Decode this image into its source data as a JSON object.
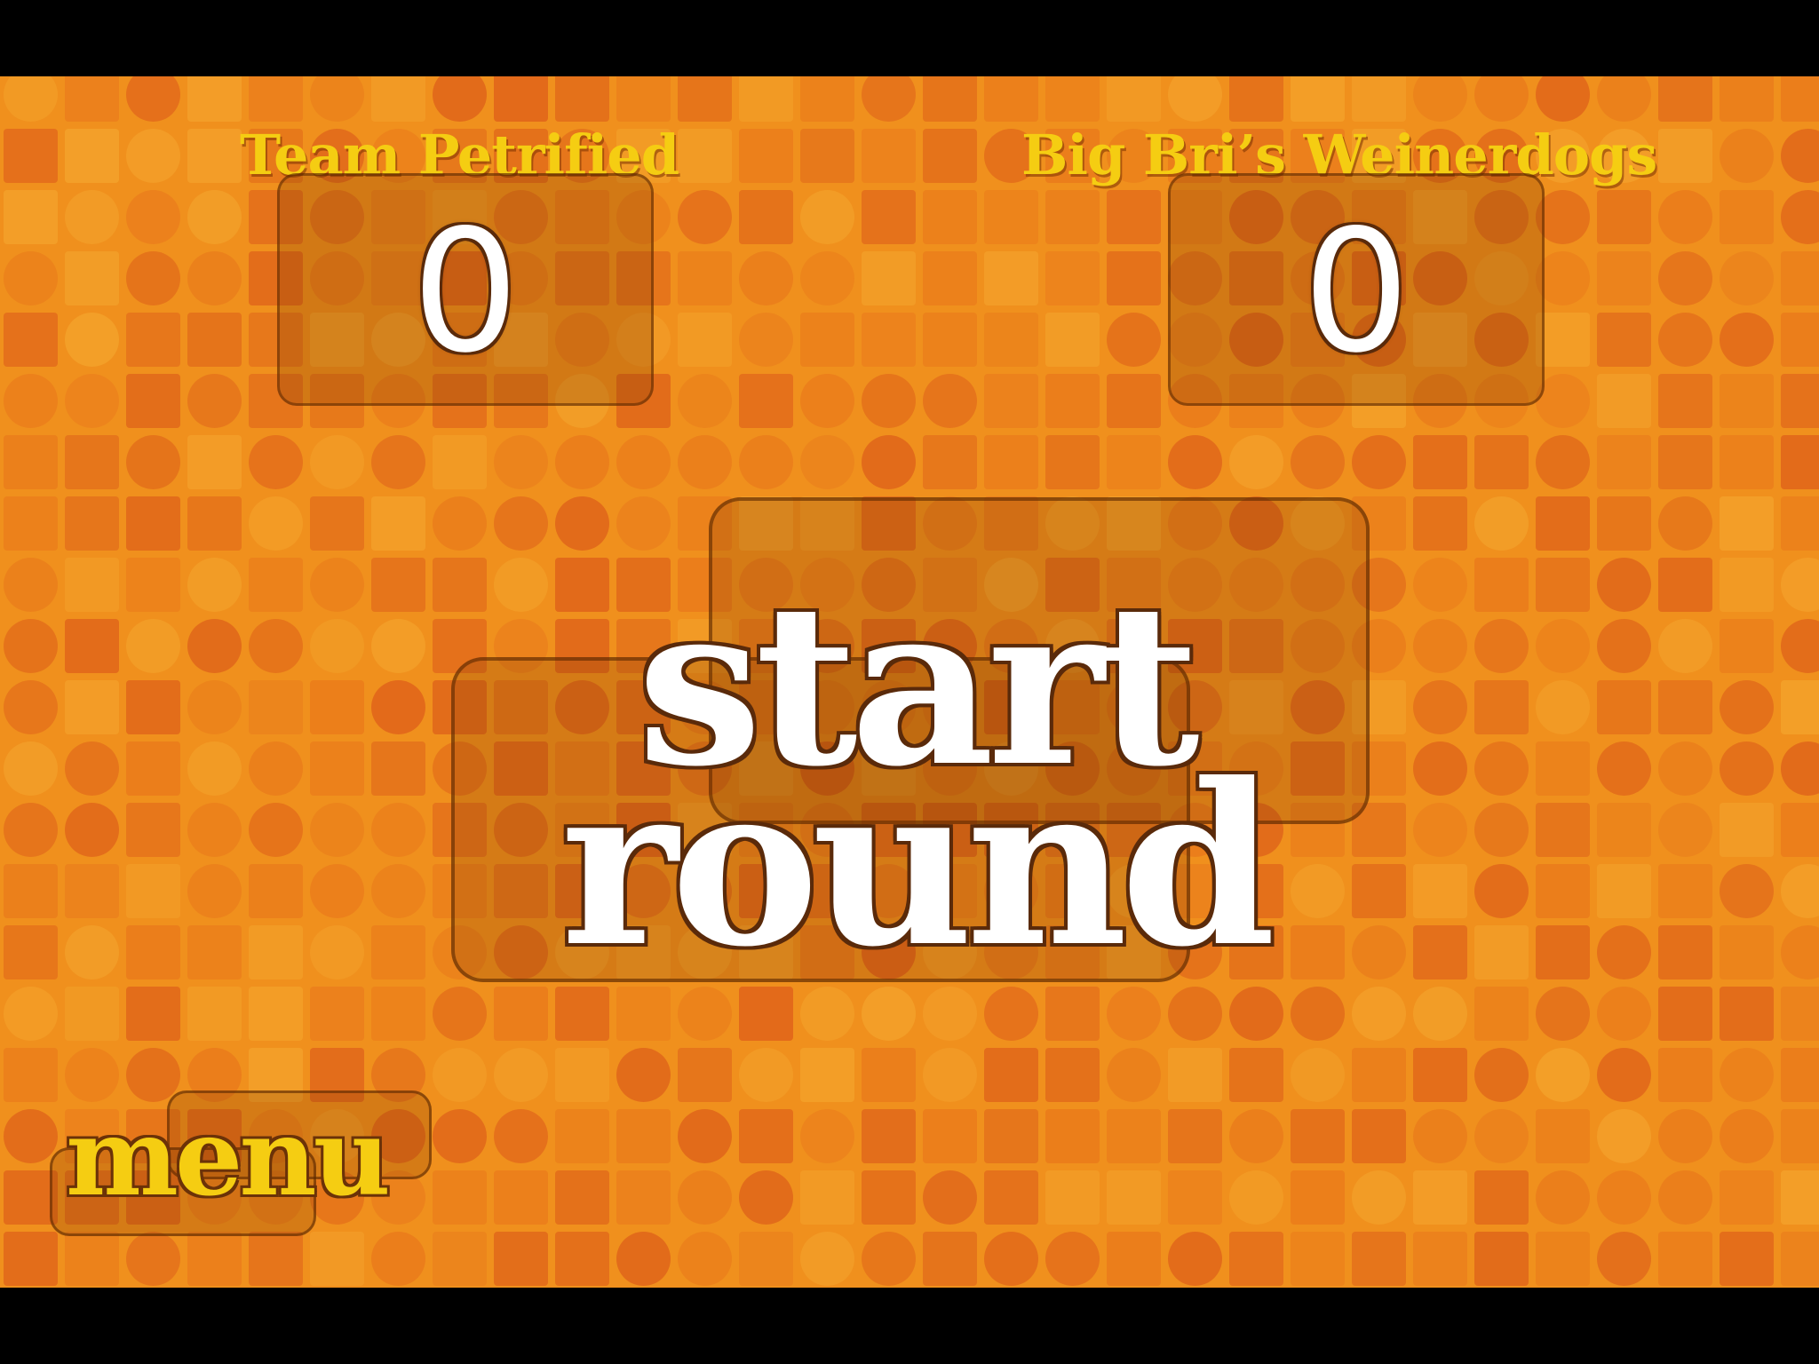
{
  "scoreboard": {
    "team1": {
      "name": "Team Petrified",
      "score": "0"
    },
    "team2": {
      "name": "Big Bri’s Weinerdogs",
      "score": "0"
    }
  },
  "start_round": {
    "line1": "start",
    "line2": "round"
  },
  "menu": {
    "label": "menu"
  },
  "colors": {
    "background_orange": "#f0901d",
    "tile_dark": "#e0661a",
    "tile_mid": "#ea7c1b",
    "tile_light": "#f3a02a",
    "accent_yellow": "#f5cd12",
    "outline_brown": "#5a2a0a",
    "letterbox": "#000000"
  }
}
